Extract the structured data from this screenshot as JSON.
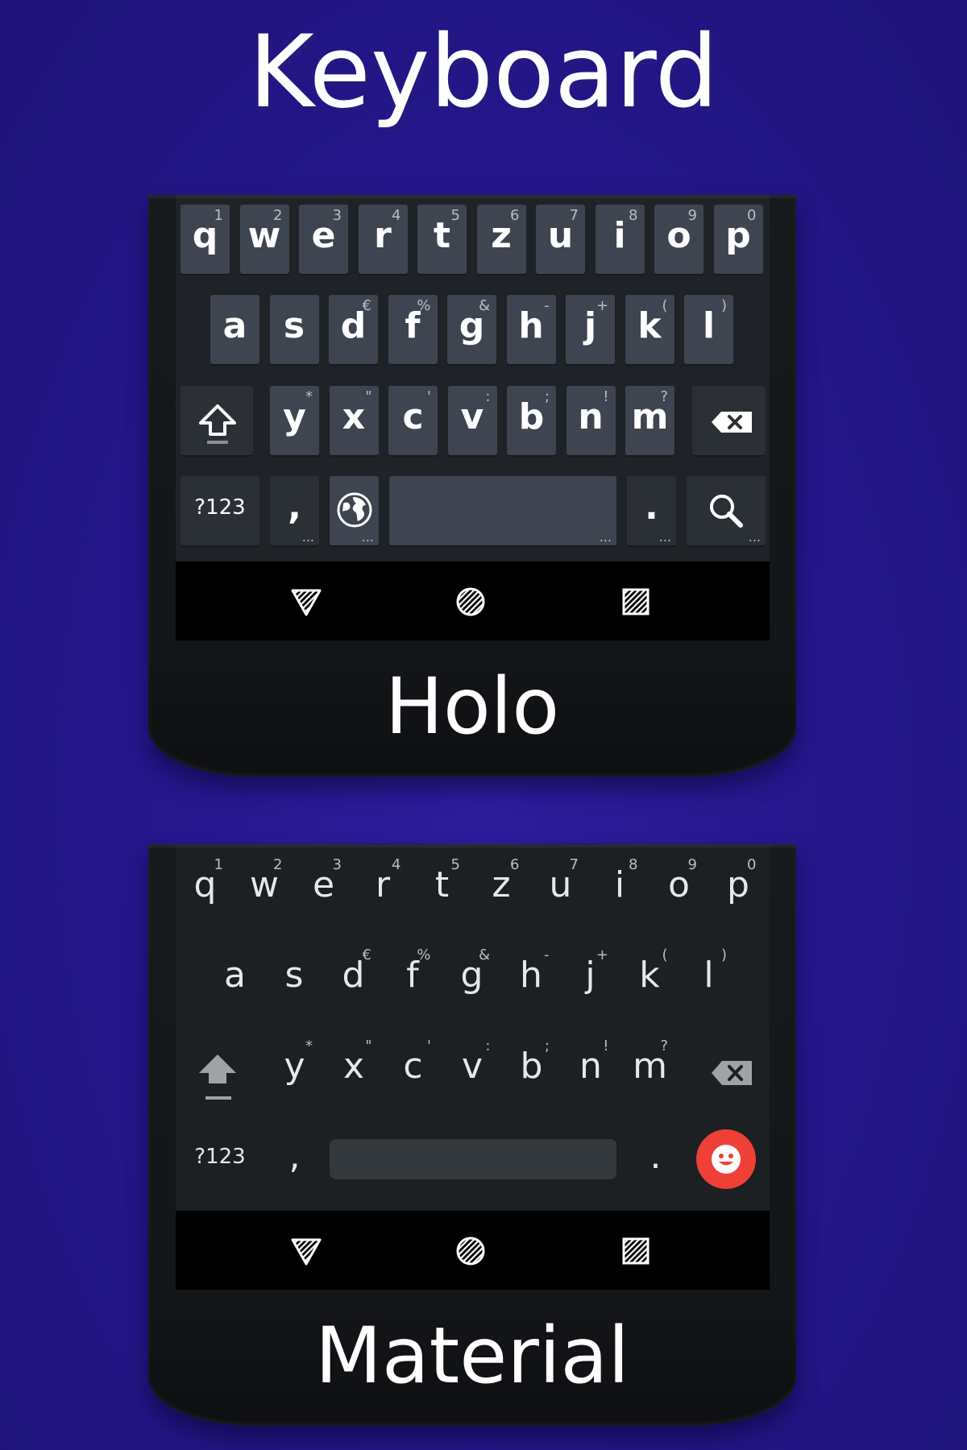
{
  "header": {
    "title": "Keyboard"
  },
  "holo": {
    "caption": "Holo",
    "row1": [
      {
        "k": "q",
        "h": "1"
      },
      {
        "k": "w",
        "h": "2"
      },
      {
        "k": "e",
        "h": "3"
      },
      {
        "k": "r",
        "h": "4"
      },
      {
        "k": "t",
        "h": "5"
      },
      {
        "k": "z",
        "h": "6"
      },
      {
        "k": "u",
        "h": "7"
      },
      {
        "k": "i",
        "h": "8"
      },
      {
        "k": "o",
        "h": "9"
      },
      {
        "k": "p",
        "h": "0"
      }
    ],
    "row2": [
      {
        "k": "a",
        "h": ""
      },
      {
        "k": "s",
        "h": ""
      },
      {
        "k": "d",
        "h": "€"
      },
      {
        "k": "f",
        "h": "%"
      },
      {
        "k": "g",
        "h": "&"
      },
      {
        "k": "h",
        "h": "-"
      },
      {
        "k": "j",
        "h": "+"
      },
      {
        "k": "k",
        "h": "("
      },
      {
        "k": "l",
        "h": ")"
      }
    ],
    "row3": [
      {
        "k": "y",
        "h": "*"
      },
      {
        "k": "x",
        "h": "\""
      },
      {
        "k": "c",
        "h": "'"
      },
      {
        "k": "v",
        "h": ":"
      },
      {
        "k": "b",
        "h": ";"
      },
      {
        "k": "n",
        "h": "!"
      },
      {
        "k": "m",
        "h": "?"
      }
    ],
    "symbols_label": "?123",
    "comma": ",",
    "period": ".",
    "more_dots": "..."
  },
  "material": {
    "caption": "Material",
    "row1": [
      {
        "k": "q",
        "h": "1"
      },
      {
        "k": "w",
        "h": "2"
      },
      {
        "k": "e",
        "h": "3"
      },
      {
        "k": "r",
        "h": "4"
      },
      {
        "k": "t",
        "h": "5"
      },
      {
        "k": "z",
        "h": "6"
      },
      {
        "k": "u",
        "h": "7"
      },
      {
        "k": "i",
        "h": "8"
      },
      {
        "k": "o",
        "h": "9"
      },
      {
        "k": "p",
        "h": "0"
      }
    ],
    "row2": [
      {
        "k": "a",
        "h": ""
      },
      {
        "k": "s",
        "h": ""
      },
      {
        "k": "d",
        "h": "€"
      },
      {
        "k": "f",
        "h": "%"
      },
      {
        "k": "g",
        "h": "&"
      },
      {
        "k": "h",
        "h": "-"
      },
      {
        "k": "j",
        "h": "+"
      },
      {
        "k": "k",
        "h": "("
      },
      {
        "k": "l",
        "h": ")"
      }
    ],
    "row3": [
      {
        "k": "y",
        "h": "*"
      },
      {
        "k": "x",
        "h": "\""
      },
      {
        "k": "c",
        "h": "'"
      },
      {
        "k": "v",
        "h": ":"
      },
      {
        "k": "b",
        "h": ";"
      },
      {
        "k": "n",
        "h": "!"
      },
      {
        "k": "m",
        "h": "?"
      }
    ],
    "symbols_label": "?123",
    "comma": ",",
    "period": "."
  },
  "icons": {
    "shift": "shift-arrow-icon",
    "backspace": "backspace-icon",
    "globe": "globe-icon",
    "search": "search-icon",
    "emoji": "emoji-icon",
    "nav_back": "back-triangle-icon",
    "nav_home": "home-circle-icon",
    "nav_recent": "recents-square-icon"
  },
  "colors": {
    "background": "#24168a",
    "holo_key": "#3e4550",
    "emoji_accent": "#ee4036"
  }
}
